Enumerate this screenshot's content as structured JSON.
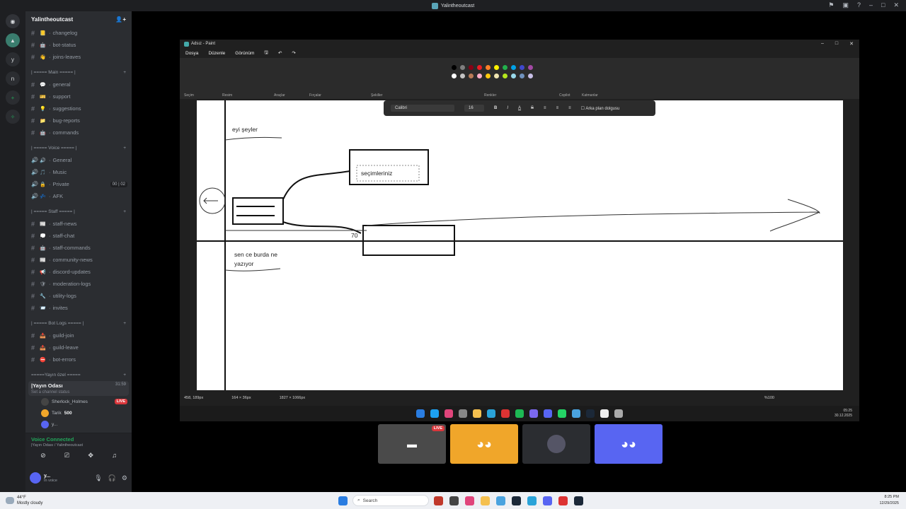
{
  "window": {
    "title": "Yalintheoutcast"
  },
  "rail": {
    "items": [
      "n",
      "y"
    ]
  },
  "server": {
    "name": "Yalintheoutcast"
  },
  "channels_top": [
    {
      "emoji": "📒",
      "name": "changelog"
    },
    {
      "emoji": "🤖",
      "name": "bot-status"
    },
    {
      "emoji": "👋",
      "name": "joins-leaves"
    }
  ],
  "cat_main": "| ===== Main ===== |",
  "channels_main": [
    {
      "emoji": "💬",
      "name": "general"
    },
    {
      "emoji": "🎫",
      "name": "support"
    },
    {
      "emoji": "💡",
      "name": "suggestions"
    },
    {
      "emoji": "📁",
      "name": "bug-reports"
    },
    {
      "emoji": "🤖",
      "name": "commands"
    }
  ],
  "cat_voice": "| ===== Voice ===== |",
  "channels_voice": [
    {
      "emoji": "🔊",
      "name": "General",
      "badge": ""
    },
    {
      "emoji": "🎵",
      "name": "Music",
      "badge": ""
    },
    {
      "emoji": "🔒",
      "name": "Private",
      "badge": "00 | 02"
    },
    {
      "emoji": "💤",
      "name": "AFK",
      "badge": ""
    }
  ],
  "cat_staff": "| ===== Staff ===== |",
  "channels_staff": [
    {
      "emoji": "📰",
      "name": "staff-news"
    },
    {
      "emoji": "💭",
      "name": "staff-chat"
    },
    {
      "emoji": "🤖",
      "name": "staff-commands"
    },
    {
      "emoji": "📰",
      "name": "community-news"
    },
    {
      "emoji": "📢",
      "name": "discord-updates"
    },
    {
      "emoji": "🛡",
      "name": "moderation-logs"
    },
    {
      "emoji": "🔧",
      "name": "utility-logs"
    },
    {
      "emoji": "📨",
      "name": "invites"
    }
  ],
  "cat_botlogs": "| ===== Bot Logs ===== |",
  "channels_botlogs": [
    {
      "emoji": "📥",
      "name": "guild-join"
    },
    {
      "emoji": "📤",
      "name": "guild-leave"
    },
    {
      "emoji": "⛔",
      "name": "bot-errors"
    }
  ],
  "cat_yayin": "=====Yayın özel =====",
  "active_voice": {
    "name": "|Yayın Odası",
    "time": "31:59",
    "status": "Set a channel status"
  },
  "members": [
    {
      "name": "Sherlock_Holmes",
      "live": "LIVE"
    },
    {
      "name": "Tarik",
      "extra": "500"
    },
    {
      "name": "y..."
    }
  ],
  "voice_panel": {
    "status": "Voice Connected",
    "sub": "|Yayın Odası / Yalintheoutcast"
  },
  "user": {
    "name": "y...",
    "status": "In voice"
  },
  "paint": {
    "title": "Adsız - Paint",
    "menus": [
      "Dosya",
      "Düzenle",
      "Görünüm"
    ],
    "groups": [
      "Seçim",
      "Resim",
      "Araçlar",
      "Fırçalar",
      "Şekiller",
      "Renkler",
      "Copilot",
      "Katmanlar"
    ],
    "font": "Calibri",
    "size": "16",
    "bg_fill": "Arka plan dolgusu",
    "canvas_texts": {
      "t1": "eyi şeyler",
      "t2": "seçimleriniz",
      "t3": "70",
      "t4": "sen ce burda ne",
      "t5": "yazıyor"
    },
    "status": {
      "pos": "458, 189px",
      "sel": "164 × 36px",
      "size": "1827 × 1066px",
      "zoom": "%100"
    },
    "inner_clock": {
      "time": "05:25",
      "date": "30.12.2025"
    }
  },
  "tiles": {
    "live": "LIVE"
  },
  "taskbar": {
    "temp": "44°F",
    "weather": "Mostly cloudy",
    "search": "Search",
    "time": "8:25 PM",
    "date": "12/29/2025"
  },
  "colors": {
    "discord_blurple": "#5865f2",
    "orange_tile": "#f0a62a",
    "live_red": "#da373c",
    "voice_green": "#23a55a"
  }
}
